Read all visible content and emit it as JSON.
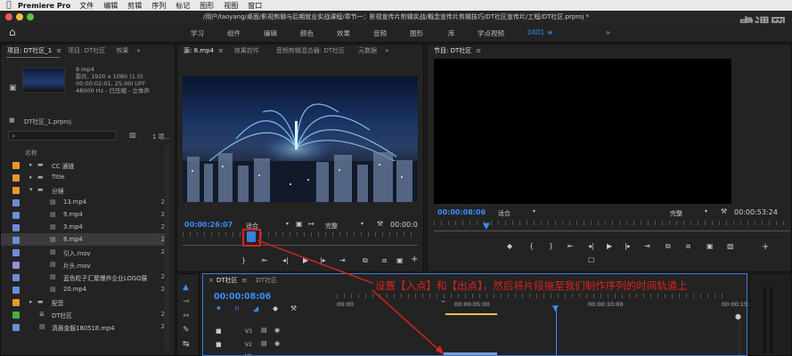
{
  "menubar": {
    "app": "Premiere Pro",
    "items": [
      "文件",
      "编辑",
      "剪辑",
      "序列",
      "标记",
      "图形",
      "视图",
      "窗口"
    ]
  },
  "titlebar": {
    "title": "/用户/laoyang/桌面/影视剪辑与后期就业实战课程/章节一：影视宣传片剪辑实战/概念宣传片剪辑技巧/DT社区宣传片/工程/DT社区.prproj *"
  },
  "watermark": "虎课网",
  "workspaces": {
    "items": [
      "学习",
      "组件",
      "编辑",
      "颜色",
      "效果",
      "音频",
      "图形",
      "库",
      "学点视频"
    ],
    "active": "0401"
  },
  "project": {
    "tabs": [
      "项目: DT社区_1",
      "项目: DT社区",
      "效果"
    ],
    "clip": {
      "name": "8.mp4",
      "line1": "影片, 1920 x 1080 (1.0)",
      "line2": "00:00:02:01, 25.00i UFF",
      "line3": "48000 Hz - 已压缩 - 立体声"
    },
    "file": "DT社区_1.prproj",
    "count": "1 项...",
    "column": "名称",
    "rows": [
      {
        "name": "CC 通链",
        "color": "#e8982b",
        "num": ""
      },
      {
        "name": "Title",
        "color": "#e8982b",
        "num": ""
      },
      {
        "name": "分镜",
        "color": "#e8982b",
        "num": ""
      },
      {
        "name": "13.mp4",
        "color": "#6b8ed8",
        "num": "2"
      },
      {
        "name": "9.mp4",
        "color": "#6b8ed8",
        "num": "2"
      },
      {
        "name": "3.mp4",
        "color": "#6b8ed8",
        "num": "2"
      },
      {
        "name": "8.mp4",
        "color": "#6b8ed8",
        "num": "2"
      },
      {
        "name": "引入.mov",
        "color": "#6b8ed8",
        "num": "2"
      },
      {
        "name": "片头.mov",
        "color": "#a685e0",
        "num": ""
      },
      {
        "name": "蓝色粒子汇聚爆炸企业LOGO展",
        "color": "#6b8ed8",
        "num": "2"
      },
      {
        "name": "20.mp4",
        "color": "#6b8ed8",
        "num": "2"
      },
      {
        "name": "配音",
        "color": "#e8982b",
        "num": ""
      },
      {
        "name": "DT社区",
        "color": "#3fb14c",
        "num": "2"
      },
      {
        "name": "清晨金服180518.mp4",
        "color": "#6b8ed8",
        "num": "2"
      }
    ]
  },
  "source": {
    "tabs": [
      "源: 8.mp4",
      "效果控件",
      "音频剪辑混合器: DT社区",
      "元数据"
    ],
    "timecode": "00:00:26:07",
    "fit": "适合",
    "quality": "完整",
    "duration": "00:00:0"
  },
  "program": {
    "tab": "节目: DT社区",
    "timecode": "00:00:08:06",
    "fit": "适合",
    "quality": "完整",
    "duration": "00:00:53:24"
  },
  "timeline": {
    "tabs": [
      "DT社区",
      "DT社区"
    ],
    "timecode": "00:00:08:06",
    "ticks": [
      ":00:00",
      "00:00:05:00",
      "00:00:10:00",
      "00:00:15:00"
    ],
    "tracks": [
      "V3",
      "V2",
      "V1"
    ]
  },
  "annotation": "设置【入点】和【出点】，然后将片段拖至我们制作序列的时间轨道上",
  "colors": {
    "accent_blue": "#2d8ceb",
    "annotation_red": "#e12020"
  }
}
